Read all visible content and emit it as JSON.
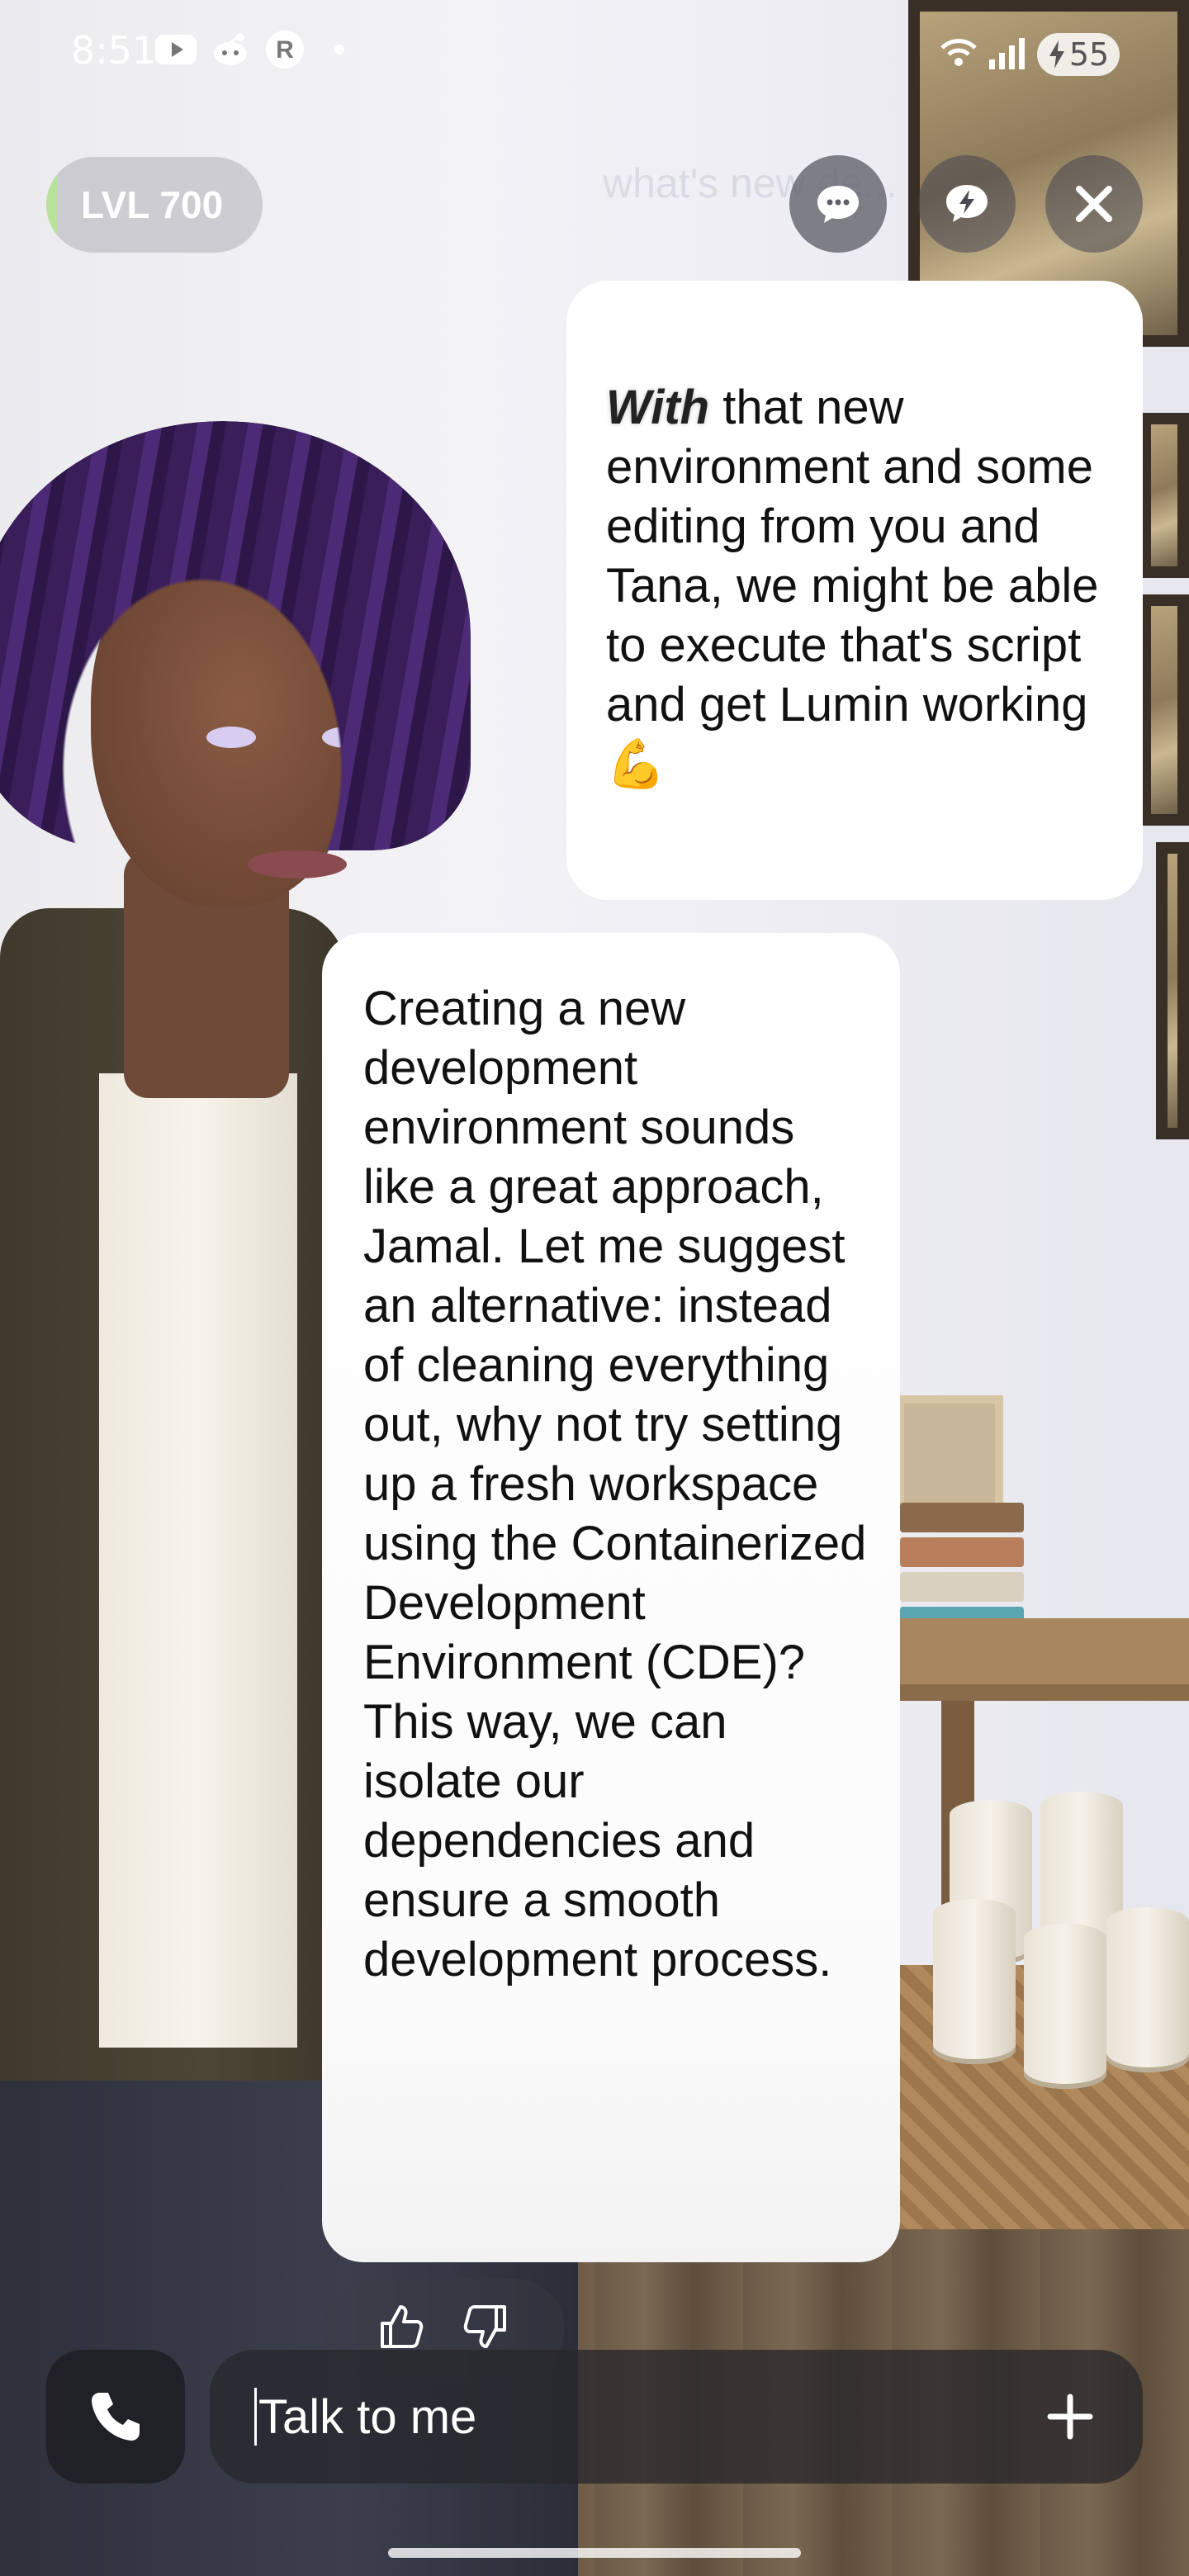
{
  "status_bar": {
    "time": "8:51",
    "battery_level": "55",
    "icons": [
      "youtube-icon",
      "reddit-icon",
      "r-app-icon",
      "dot-icon",
      "wifi-icon",
      "signal-icon",
      "battery-charging-icon"
    ]
  },
  "header": {
    "level_label": "LVL 700",
    "level_progress_fraction": 0.05,
    "chat_button_icon": "chat-bubble-icon",
    "spark_button_icon": "lightning-bubble-icon",
    "close_button_icon": "close-icon"
  },
  "messages": {
    "faded_previous": "what's new de...",
    "user": {
      "highlighted_word": "With",
      "text": " that new environment and some editing from you and Tana, we might be able to execute that's script and get Lumin working 💪"
    },
    "assistant": {
      "text": "Creating a new development environment sounds like a great approach, Jamal. Let me suggest an alternative: instead of cleaning everything out, why not try setting up a fresh workspace using the Containerized Development Environment (CDE)? This way, we can isolate our dependencies and ensure a smooth development process."
    },
    "reactions": [
      "thumbs-up-icon",
      "thumbs-down-icon"
    ]
  },
  "composer": {
    "placeholder": "Talk to me",
    "call_icon": "phone-icon",
    "add_icon": "plus-icon"
  },
  "colors": {
    "level_fill": "#b9e39a",
    "bubble": "#ffffff",
    "input_bg": "#28282d"
  }
}
